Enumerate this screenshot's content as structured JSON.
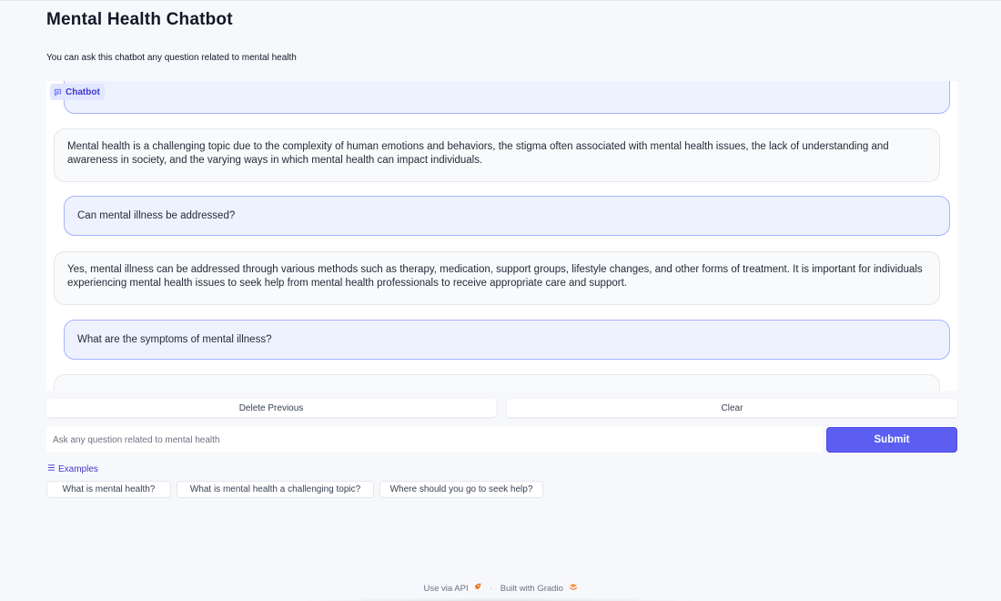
{
  "app": {
    "title": "Mental Health Chatbot",
    "description": "You can ask this chatbot any question related to mental health"
  },
  "chatbot": {
    "label": "Chatbot",
    "icon": "chat-bubble-icon",
    "messages": [
      {
        "role": "user",
        "text": ""
      },
      {
        "role": "bot",
        "text": "Mental health is a challenging topic due to the complexity of human emotions and behaviors, the stigma often associated with mental health issues, the lack of understanding and awareness in society, and the varying ways in which mental health can impact individuals."
      },
      {
        "role": "user",
        "text": "Can mental illness be addressed?"
      },
      {
        "role": "bot",
        "text": "Yes, mental illness can be addressed through various methods such as therapy, medication, support groups, lifestyle changes, and other forms of treatment. It is important for individuals experiencing mental health issues to seek help from mental health professionals to receive appropriate care and support."
      },
      {
        "role": "user",
        "text": "What are the symptoms of mental illness?"
      },
      {
        "role": "bot",
        "text": ""
      }
    ]
  },
  "actions": {
    "delete_previous": "Delete Previous",
    "clear": "Clear",
    "submit": "Submit"
  },
  "input": {
    "placeholder": "Ask any question related to mental health",
    "value": ""
  },
  "examples": {
    "label": "Examples",
    "icon": "list-icon",
    "items": [
      "What is mental health?",
      "What is mental health a challenging topic?",
      "Where should you go to seek help?"
    ]
  },
  "footer": {
    "api_text": "Use via API",
    "api_icon": "rocket-icon",
    "built_with": "Built with Gradio",
    "gradio_icon": "gradio-logo-icon"
  },
  "colors": {
    "accent": "#5b5ef0",
    "user_bubble": "#eef2ff",
    "user_border": "#a5b4fc",
    "bot_bubble": "#f9fafb"
  }
}
